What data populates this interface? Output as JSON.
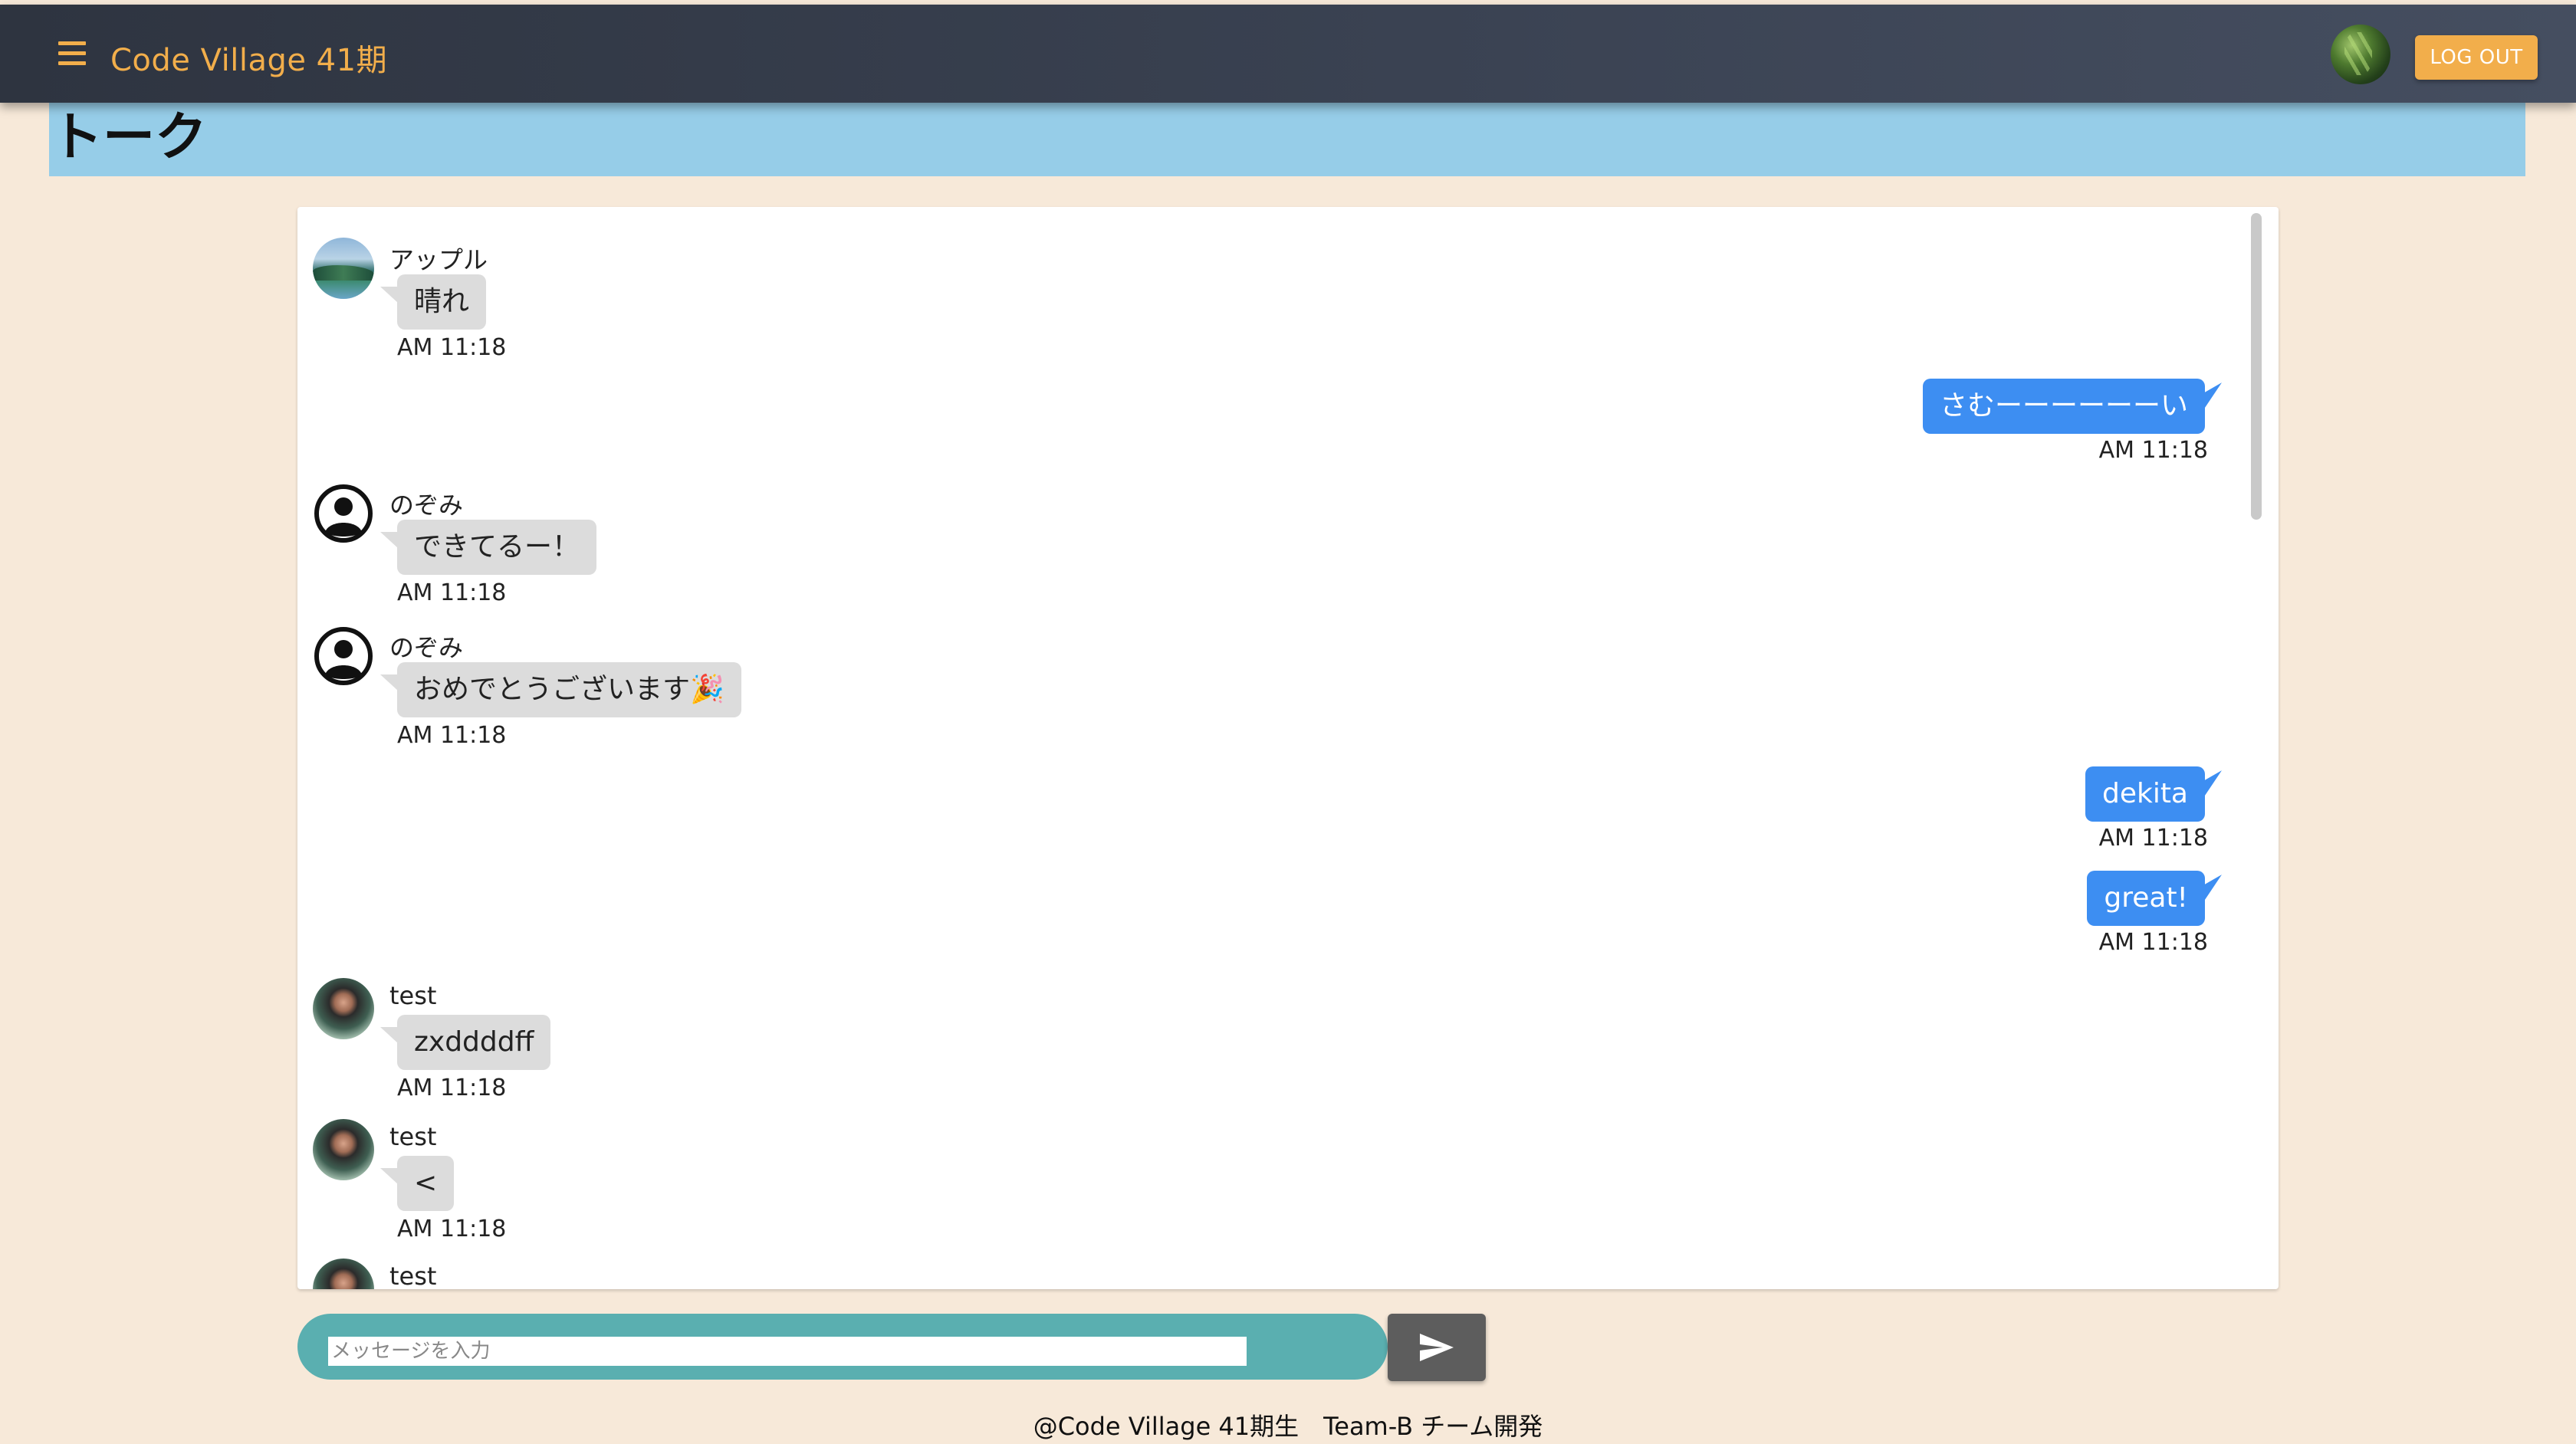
{
  "app_bar": {
    "title": "Code Village 41期",
    "logout_label": "LOG OUT",
    "menu_icon": "hamburger-menu-icon",
    "accent_color": "#f2ae4b"
  },
  "page_header": {
    "title": "トーク",
    "background_color": "#96cde8"
  },
  "messages": [
    {
      "direction": "in",
      "sender": "アップル",
      "text": "晴れ",
      "time": "AM 11:18",
      "avatar": "landscape-photo"
    },
    {
      "direction": "out",
      "text": "さむーーーーーーい",
      "time": "AM 11:18"
    },
    {
      "direction": "in",
      "sender": "のぞみ",
      "text": "できてるー！",
      "time": "AM 11:18",
      "avatar": "default-user-icon"
    },
    {
      "direction": "in",
      "sender": "のぞみ",
      "text": "おめでとうございます🎉",
      "time": "AM 11:18",
      "avatar": "default-user-icon"
    },
    {
      "direction": "out",
      "text": "dekita",
      "time": "AM 11:18"
    },
    {
      "direction": "out",
      "text": "great!",
      "time": "AM 11:18"
    },
    {
      "direction": "in",
      "sender": "test",
      "text": "zxddddff",
      "time": "AM 11:18",
      "avatar": "character-photo"
    },
    {
      "direction": "in",
      "sender": "test",
      "text": "<",
      "time": "AM 11:18",
      "avatar": "character-photo"
    },
    {
      "direction": "in",
      "sender": "test",
      "text": "",
      "time": "",
      "avatar": "character-photo"
    }
  ],
  "colors": {
    "outgoing_bubble": "#3d8ef2",
    "incoming_bubble": "#dcdcdc",
    "input_bar": "#5aafb0",
    "send_button": "#5d5d5d"
  },
  "composer": {
    "placeholder": "メッセージを入力",
    "value": "",
    "send_icon": "send-icon"
  },
  "footer": {
    "text": "@Code Village 41期生　Team-B チーム開発"
  }
}
